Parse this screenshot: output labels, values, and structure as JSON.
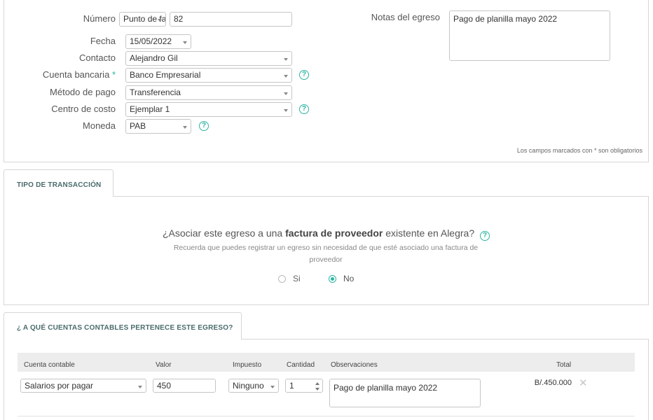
{
  "form": {
    "numero_label": "Número",
    "numero_prefix": "Punto de fa",
    "numero_value": "82",
    "fecha_label": "Fecha",
    "fecha_value": "15/05/2022",
    "contacto_label": "Contacto",
    "contacto_value": "Alejandro Gil",
    "cuenta_label": "Cuenta bancaria",
    "cuenta_required": "*",
    "cuenta_value": "Banco Empresarial",
    "metodo_label": "Método de pago",
    "metodo_value": "Transferencia",
    "centro_label": "Centro de costo",
    "centro_value": "Ejemplar 1",
    "moneda_label": "Moneda",
    "moneda_value": "PAB",
    "notas_label": "Notas del egreso",
    "notas_value": "Pago de planilla mayo 2022",
    "required_note": "Los campos marcados con * son obligatorios",
    "help_glyph": "?"
  },
  "transaction": {
    "tab_label": "TIPO DE TRANSACCIÓN",
    "question_pre": "¿Asociar este egreso a una ",
    "question_bold": "factura de proveedor",
    "question_post": " existente en Alegra?",
    "hint": "Recuerda que puedes registrar un egreso sin necesidad de que esté asociado una factura de proveedor",
    "option_si": "Si",
    "option_no": "No",
    "selected": "No"
  },
  "accounts": {
    "tab_label": "¿ A QUÉ CUENTAS CONTABLES PERTENECE ESTE EGRESO?",
    "headers": {
      "cuenta": "Cuenta contable",
      "valor": "Valor",
      "impuesto": "Impuesto",
      "cantidad": "Cantidad",
      "observaciones": "Observaciones",
      "total": "Total"
    },
    "row": {
      "cuenta": "Salarios por pagar",
      "valor": "450",
      "impuesto": "Ninguno",
      "cantidad": "1",
      "observaciones": "Pago de planilla mayo 2022",
      "total": "B/.450.000",
      "remove_glyph": "✕"
    }
  },
  "colors": {
    "accent": "#2bb5a0",
    "border": "#d6d6d6",
    "header_bg": "#ededed"
  }
}
